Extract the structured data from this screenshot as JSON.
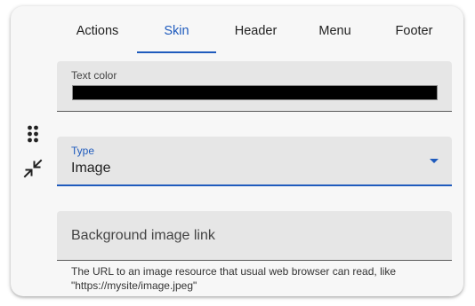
{
  "tabs": [
    {
      "label": "Actions",
      "active": false
    },
    {
      "label": "Skin",
      "active": true
    },
    {
      "label": "Header",
      "active": false
    },
    {
      "label": "Menu",
      "active": false
    },
    {
      "label": "Footer",
      "active": false
    }
  ],
  "tools": {
    "drag_icon": "drag-handle-icon",
    "collapse_icon": "collapse-icon"
  },
  "text_color_field": {
    "label": "Text color",
    "value": "#000000"
  },
  "type_field": {
    "label": "Type",
    "value": "Image"
  },
  "background_image_field": {
    "placeholder": "Background image link",
    "helper_text": "The URL to an image resource that usual web browser can read, like \"https://mysite/image.jpeg\""
  },
  "colors": {
    "accent": "#1f5bbd",
    "field_bg": "#e6e6e6",
    "card_bg": "#f7f7f7"
  }
}
